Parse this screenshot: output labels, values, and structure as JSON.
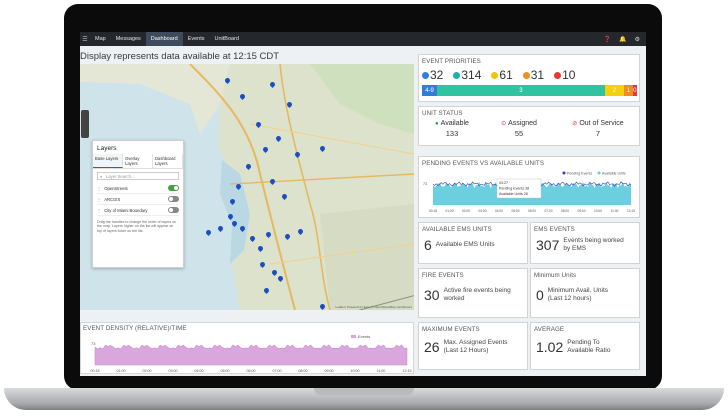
{
  "nav": {
    "items": [
      "Map",
      "Messages",
      "Dashboard",
      "Events",
      "UnitBoard"
    ],
    "active_index": 2,
    "right_icons": [
      "help-icon",
      "bell-icon",
      "settings-icon"
    ]
  },
  "display_title": "Display represents data available at 12:15 CDT",
  "layers": {
    "title": "Layers",
    "tabs": [
      "Base Layers",
      "Overlay Layers",
      "Dashboard Layers"
    ],
    "active_tab": 0,
    "search_placeholder": "Layer Search...",
    "items": [
      {
        "label": "OpenStreets",
        "on": true
      },
      {
        "label": "ARCGIS",
        "on": false
      },
      {
        "label": "City of Miami Boundary",
        "on": false
      }
    ],
    "note": "Drag the handles to change the order of layers on the map. Layers higher on the list will appear on top of layers lower on the list.",
    "attribution": "Leaflet | Powered by Esri | © OpenStreetMap contributors"
  },
  "event_density": {
    "title": "EVENT DENSITY (RELATIVE)/TIME",
    "legend": "Events",
    "y_label": "73",
    "x_ticks": [
      "00:18",
      "01:00",
      "02:00",
      "03:00",
      "04:00",
      "05:00",
      "06:00",
      "07:00",
      "08:00",
      "09:00",
      "10:00",
      "11:00",
      "12:15"
    ]
  },
  "event_priorities": {
    "title": "EVENT PRIORITIES",
    "counts": [
      {
        "value": "32",
        "color": "#2f7fd9"
      },
      {
        "value": "314",
        "color": "#1bb3a6"
      },
      {
        "value": "61",
        "color": "#f4c20d"
      },
      {
        "value": "31",
        "color": "#f28c1e"
      },
      {
        "value": "10",
        "color": "#e53935"
      }
    ],
    "bar": [
      {
        "label": "4-9",
        "fraction": 0.07,
        "color": "#2f7fd9"
      },
      {
        "label": "3",
        "fraction": 0.78,
        "color": "#2ec4a0"
      },
      {
        "label": "2",
        "fraction": 0.09,
        "color": "#f4d00d"
      },
      {
        "label": "1",
        "fraction": 0.04,
        "color": "#f28c1e"
      },
      {
        "label": "0",
        "fraction": 0.02,
        "color": "#e53935"
      }
    ]
  },
  "unit_status": {
    "title": "UNIT STATUS",
    "items": [
      {
        "label": "Available",
        "value": "133",
        "color": "#2e9e3e"
      },
      {
        "label": "Assigned",
        "value": "55",
        "color": "#c2188b"
      },
      {
        "label": "Out of Service",
        "value": "7",
        "color": "#e53935"
      }
    ]
  },
  "pending_vs_available": {
    "title": "PENDING EVENTS VS AVAILABLE UNITS",
    "legend": [
      "Pending Events",
      "Available Units"
    ],
    "y_label": "73",
    "tooltip": {
      "time": "03:27",
      "rows": [
        "Pending Events 38",
        "Available Units 28"
      ]
    },
    "x_ticks": [
      "00:18",
      "01:00",
      "02:00",
      "03:00",
      "04:00",
      "05:00",
      "06:00",
      "07:00",
      "08:00",
      "09:00",
      "10:00",
      "11:00",
      "12:15"
    ]
  },
  "metrics": [
    {
      "title": "AVAILABLE EMS UNITS",
      "value": "6",
      "desc": "Available EMS Units"
    },
    {
      "title": "EMS EVENTS",
      "value": "307",
      "desc": "Events being worked by EMS"
    },
    {
      "title": "FIRE EVENTS",
      "value": "30",
      "desc": "Active fire events being worked"
    },
    {
      "title": "Minimum Units",
      "value": "0",
      "desc": "Minimum Avail. Units (Last 12 hours)"
    },
    {
      "title": "MAXIMUM EVENTS",
      "value": "26",
      "desc": "Max. Assigned Events (Last 12 Hours)"
    },
    {
      "title": "AVERAGE",
      "value": "1.02",
      "desc": "Pending To Available Ratio"
    }
  ],
  "colors": {
    "nav_bg": "#24272b",
    "pin": "#1b4fbf",
    "density_fill": "#d9a6dd",
    "available_fill": "#6ccfe0",
    "pending_line": "#3b3fae"
  }
}
